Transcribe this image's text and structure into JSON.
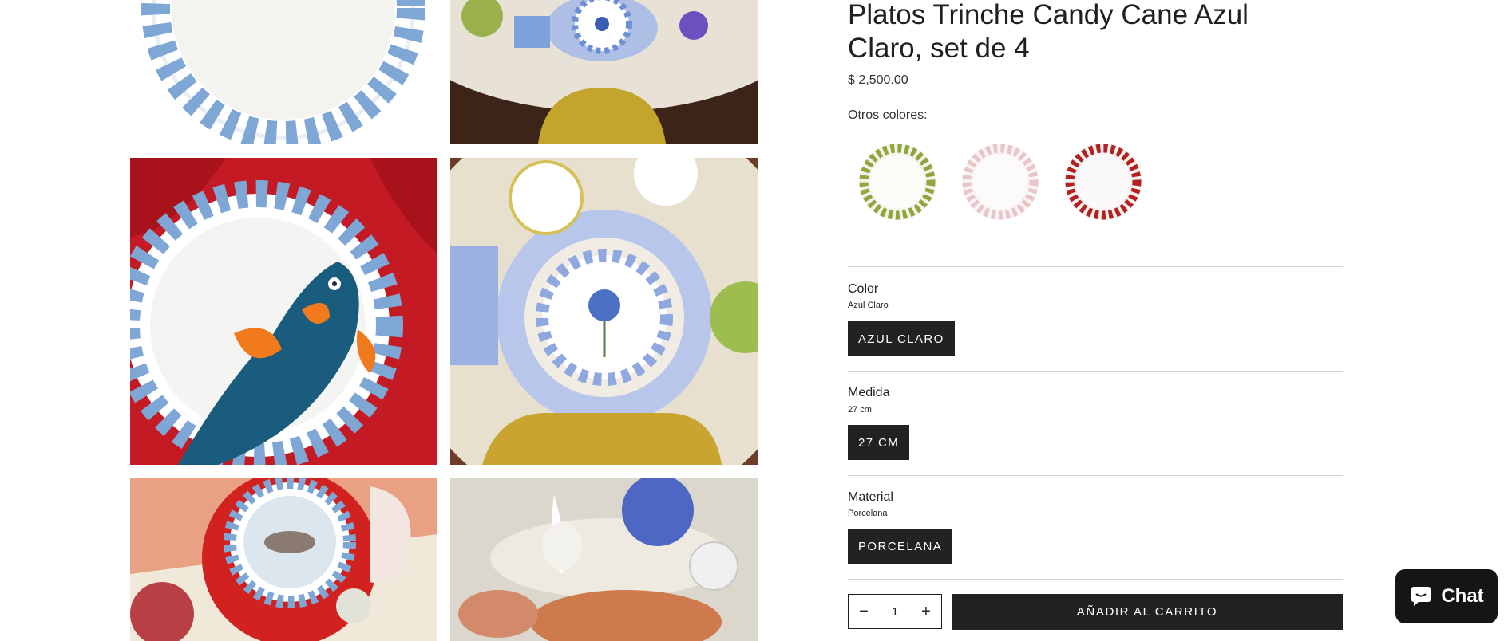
{
  "product": {
    "title": "Platos Trinche Candy Cane Azul Claro, set de 4",
    "price": "$ 2,500.00"
  },
  "other_colors": {
    "label": "Otros colores:",
    "swatches": [
      {
        "name": "green-stripe-plate",
        "color": "#8fa63a"
      },
      {
        "name": "pink-stripe-plate",
        "color": "#e8c6c8"
      },
      {
        "name": "red-stripe-plate",
        "color": "#b3211e"
      }
    ]
  },
  "options": {
    "color": {
      "name": "Color",
      "value": "Azul Claro",
      "button": "AZUL CLARO"
    },
    "size": {
      "name": "Medida",
      "value": "27 cm",
      "button": "27 CM"
    },
    "material": {
      "name": "Material",
      "value": "Porcelana",
      "button": "PORCELANA"
    }
  },
  "cart": {
    "quantity": "1",
    "minus": "−",
    "plus": "+",
    "add_label": "AÑADIR AL CARRITO"
  },
  "chat": {
    "label": "Chat"
  },
  "colors": {
    "accent": "#222222",
    "stripe_blue": "#7ea7d6"
  }
}
